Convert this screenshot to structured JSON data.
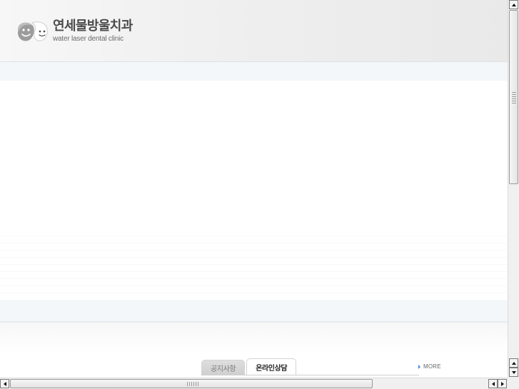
{
  "header": {
    "brand_korean": "연세물방울치과",
    "brand_english": "water laser dental clinic"
  },
  "board": {
    "tabs": [
      {
        "label": "공지사항",
        "active": false
      },
      {
        "label": "온라인상담",
        "active": true
      }
    ],
    "more_label": "MORE"
  },
  "colors": {
    "band": "#f3f7fa",
    "text_dark": "#4a4a4a",
    "more_arrow": "#3b8fd6"
  },
  "icons": {
    "logo": "tooth-mascot-icon",
    "more": "caret-right-icon",
    "scroll_up": "arrow-up-icon",
    "scroll_down": "arrow-down-icon",
    "scroll_left": "arrow-left-icon",
    "scroll_right": "arrow-right-icon"
  }
}
